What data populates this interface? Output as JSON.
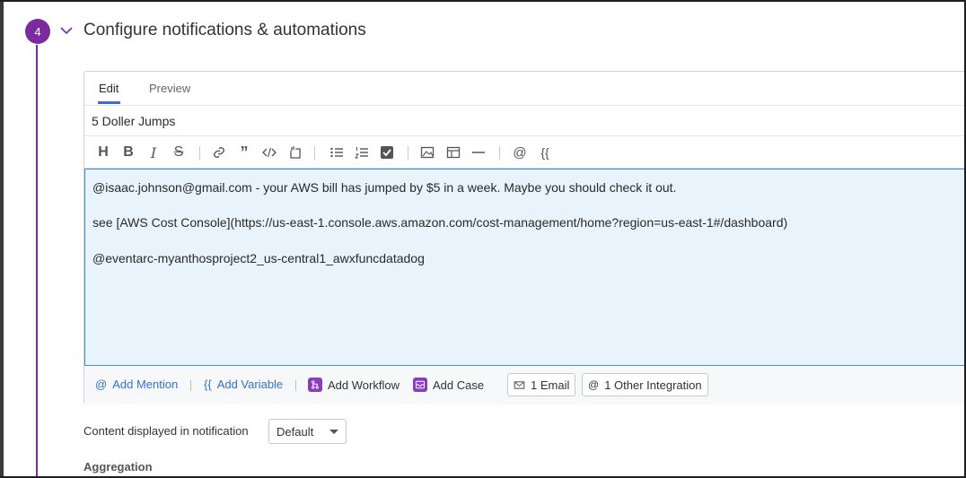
{
  "step": {
    "number": "4",
    "title": "Configure notifications & automations",
    "accent_color": "#7b2aa0"
  },
  "editor": {
    "tabs": [
      {
        "label": "Edit",
        "active": true
      },
      {
        "label": "Preview",
        "active": false
      }
    ],
    "title_value": "5 Doller Jumps",
    "toolbar_icons": [
      "heading-icon",
      "bold-icon",
      "italic-icon",
      "strikethrough-icon",
      "link-icon",
      "quote-icon",
      "code-icon",
      "code-block-icon",
      "bullet-list-icon",
      "numbered-list-icon",
      "checklist-icon",
      "image-icon",
      "table-icon",
      "horizontal-rule-icon",
      "mention-icon",
      "variable-icon"
    ],
    "toolbar_labels": {
      "heading": "H",
      "bold": "B",
      "italic": "I",
      "strike": "S",
      "quote": "”",
      "mention": "@",
      "variable": "{{"
    },
    "body_lines": [
      "@isaac.johnson@gmail.com - your AWS bill has jumped by $5 in a week.  Maybe you should check it out.",
      "see [AWS Cost Console](https://us-east-1.console.aws.amazon.com/cost-management/home?region=us-east-1#/dashboard)",
      "@eventarc-myanthosproject2_us-central1_awxfuncdatadog"
    ],
    "footer": {
      "add_mention": "Add Mention",
      "add_mention_icon": "@",
      "add_variable": "Add Variable",
      "add_variable_icon": "{{",
      "add_workflow": "Add Workflow",
      "add_case": "Add Case",
      "email_chip": "1 Email",
      "integration_chip": "1 Other Integration",
      "integration_icon": "@"
    }
  },
  "content_displayed": {
    "label": "Content displayed in notification",
    "selected": "Default"
  },
  "aggregation": {
    "label": "Aggregation"
  }
}
